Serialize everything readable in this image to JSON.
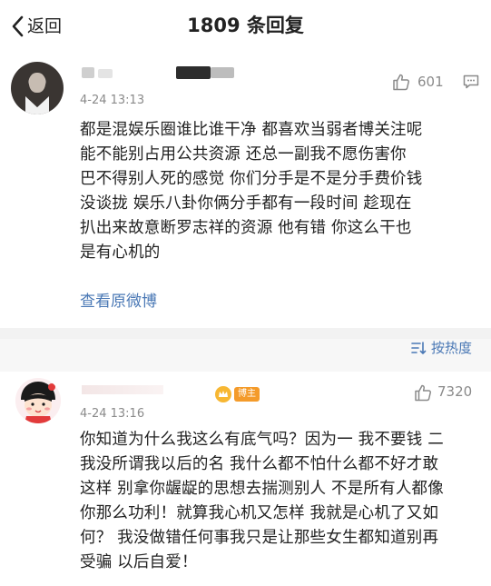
{
  "header": {
    "back_label": "返回",
    "title": "1809 条回复"
  },
  "comment_main": {
    "timestamp": "4-24 13:13",
    "like_count": "601",
    "text_lines": [
      "都是混娱乐圈谁比谁干净  都喜欢当弱者博关注呢",
      "能不能别占用公共资源  还总一副我不愿伤害你",
      "巴不得别人死的感觉  你们分手是不是分手费价钱",
      "没谈拢   娱乐八卦你俩分手都有一段时间 趁现在",
      "扒出来故意断罗志祥的资源  他有错  你这么干也",
      "是有心机的"
    ],
    "view_original_label": "查看原微博"
  },
  "sort": {
    "label": "按热度"
  },
  "comment_reply": {
    "badge_label": "博主",
    "timestamp": "4-24 13:16",
    "like_count": "7320",
    "text_lines": [
      "你知道为什么我这么有底气吗？因为一 我不要钱 二",
      "我没所谓我以后的名 我什么都不怕什么都不好才敢",
      "这样 别拿你龌龊的思想去揣测别人 不是所有人都像",
      "你那么功利！就算我心机又怎样 我就是心机了又如",
      "何？ 我没做错任何事我只是让那些女生都知道别再",
      "受骗 以后自爱！"
    ]
  },
  "colors": {
    "link_blue": "#4a78b5",
    "meta_gray": "#8a8a8a",
    "badge_orange": "#f49b2a",
    "separator_gray": "#f2f2f2"
  },
  "icons": [
    "back-chevron-icon",
    "thumbs-up-icon",
    "reply-icon",
    "sort-icon",
    "vip-crown-icon"
  ]
}
